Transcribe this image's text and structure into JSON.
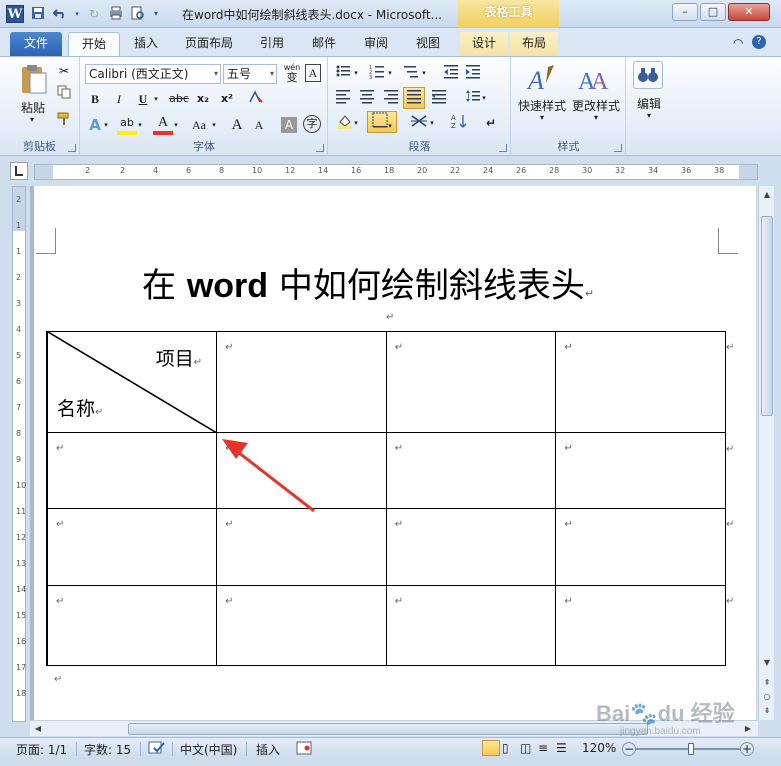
{
  "window": {
    "app_icon_letter": "W",
    "title": "在word中如何绘制斜线表头.docx - Microsoft...",
    "contextual_tab_group": "表格工具",
    "minimize_glyph": "–",
    "maximize_glyph": "□",
    "close_glyph": "✕"
  },
  "tabs": {
    "file": "文件",
    "home": "开始",
    "insert": "插入",
    "page_layout": "页面布局",
    "references": "引用",
    "mailings": "邮件",
    "review": "审阅",
    "view": "视图",
    "design": "设计",
    "layout": "布局"
  },
  "ribbon": {
    "clipboard": {
      "label": "剪贴板",
      "paste_label": "粘贴"
    },
    "font": {
      "label": "字体",
      "font_name": "Calibri (西文正文)",
      "font_size": "五号",
      "bold": "B",
      "italic": "I",
      "underline": "U",
      "strikethrough": "abc",
      "subscript": "x₂",
      "superscript": "x²",
      "grow": "A",
      "shrink": "A",
      "change_case": "Aa",
      "pinyin": "wén",
      "pinyin_char": "变",
      "char_border": "A",
      "char_shade": "A",
      "enclose": "字",
      "text_effect": "A",
      "highlight": "ab",
      "font_color": "A"
    },
    "paragraph": {
      "label": "段落"
    },
    "styles": {
      "label": "样式",
      "quick_styles": "快速样式",
      "change_styles": "更改样式"
    },
    "editing": {
      "label": "编辑"
    }
  },
  "ruler": {
    "h_numbers": [
      "2",
      "2",
      "4",
      "6",
      "8",
      "10",
      "12",
      "14",
      "16",
      "18",
      "20",
      "22",
      "24",
      "26",
      "28",
      "30",
      "32",
      "34",
      "36",
      "38"
    ],
    "v_numbers": [
      "2",
      "1",
      "1",
      "2",
      "3",
      "4",
      "5",
      "6",
      "7",
      "8",
      "9",
      "10",
      "11",
      "12",
      "13",
      "14",
      "15",
      "16",
      "17",
      "18"
    ]
  },
  "document": {
    "heading_prefix": "在 ",
    "heading_bold": "word",
    "heading_suffix": " 中如何绘制斜线表头",
    "para_mark": "↵",
    "header_cell": {
      "item": "项目",
      "name": "名称"
    }
  },
  "statusbar": {
    "page": "页面: 1/1",
    "words": "字数: 15",
    "language": "中文(中国)",
    "insert_mode": "插入",
    "zoom": "120%",
    "zoom_level_percent": 120,
    "minus": "−",
    "plus": "+"
  },
  "watermark": {
    "text": "Bai\u0000du经验",
    "url": "jingyan.baidu.com"
  },
  "colors": {
    "accent": "#2a64b4",
    "context_tab": "#f1cf5c",
    "arrow": "#e8332c"
  }
}
